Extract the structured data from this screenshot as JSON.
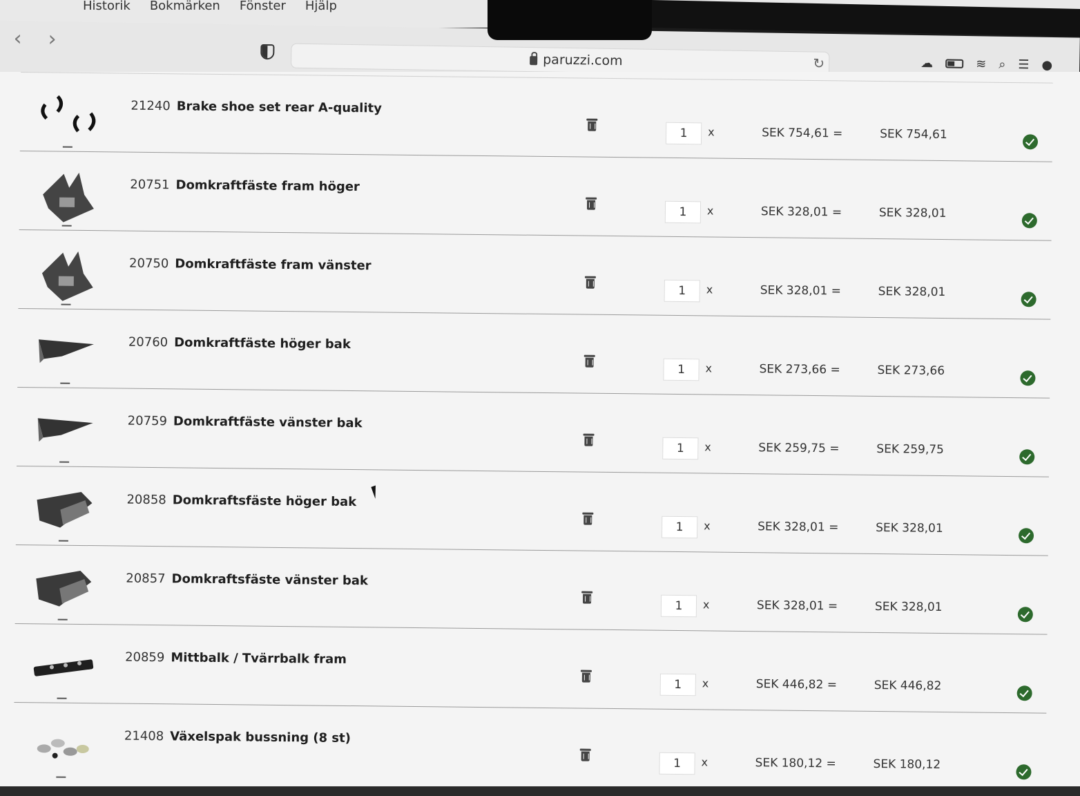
{
  "menubar": {
    "items": [
      "Historik",
      "Bokmärken",
      "Fönster",
      "Hjälp"
    ]
  },
  "browser": {
    "url": "paruzzi.com"
  },
  "cart": {
    "rows": [
      {
        "code": "21240",
        "name": "Brake shoe set rear A-quality",
        "qty": "1",
        "times": "x",
        "unit": "SEK 754,61 =",
        "total": "SEK 754,61",
        "thumb": "brake-shoe"
      },
      {
        "code": "20751",
        "name": "Domkraftfäste fram höger",
        "qty": "1",
        "times": "x",
        "unit": "SEK 328,01 =",
        "total": "SEK 328,01",
        "thumb": "bracket-front"
      },
      {
        "code": "20750",
        "name": "Domkraftfäste fram vänster",
        "qty": "1",
        "times": "x",
        "unit": "SEK 328,01 =",
        "total": "SEK 328,01",
        "thumb": "bracket-front"
      },
      {
        "code": "20760",
        "name": "Domkraftfäste höger bak",
        "qty": "1",
        "times": "x",
        "unit": "SEK 273,66 =",
        "total": "SEK 273,66",
        "thumb": "bracket-rear"
      },
      {
        "code": "20759",
        "name": "Domkraftfäste vänster bak",
        "qty": "1",
        "times": "x",
        "unit": "SEK 259,75 =",
        "total": "SEK 259,75",
        "thumb": "bracket-rear"
      },
      {
        "code": "20858",
        "name": "Domkraftsfäste höger bak",
        "qty": "1",
        "times": "x",
        "unit": "SEK 328,01 =",
        "total": "SEK 328,01",
        "thumb": "bracket-box"
      },
      {
        "code": "20857",
        "name": "Domkraftsfäste vänster bak",
        "qty": "1",
        "times": "x",
        "unit": "SEK 328,01 =",
        "total": "SEK 328,01",
        "thumb": "bracket-box"
      },
      {
        "code": "20859",
        "name": "Mittbalk / Tvärrbalk fram",
        "qty": "1",
        "times": "x",
        "unit": "SEK 446,82 =",
        "total": "SEK 446,82",
        "thumb": "beam"
      },
      {
        "code": "21408",
        "name": "Växelspak bussning (8 st)",
        "qty": "1",
        "times": "x",
        "unit": "SEK 180,12 =",
        "total": "SEK 180,12",
        "thumb": "bushings"
      }
    ]
  },
  "colors": {
    "ok_badge": "#2d6a2d",
    "page_bg": "#f4f4f4",
    "divider": "#9a9a9a"
  }
}
